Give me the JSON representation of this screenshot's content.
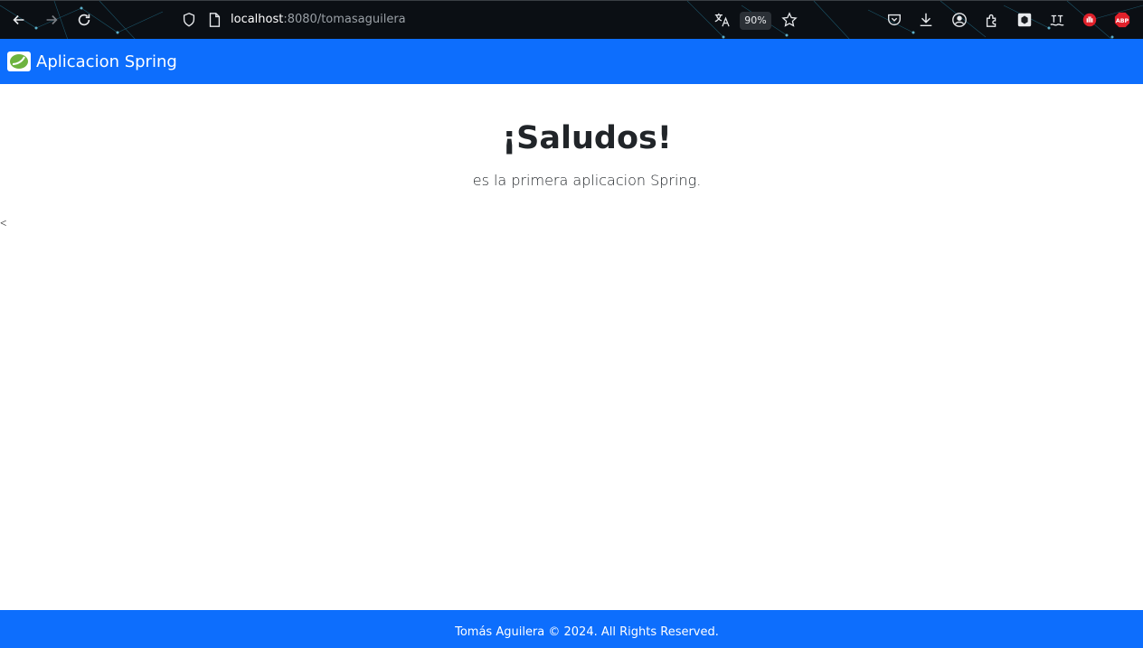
{
  "browser": {
    "url_host": "localhost",
    "url_rest": ":8080/tomasaguilera",
    "zoom": "90%",
    "icons": [
      "back-icon",
      "forward-icon",
      "reload-icon",
      "shield-icon",
      "page-icon",
      "translate-icon",
      "bookmark-star-icon",
      "pocket-icon",
      "download-icon",
      "account-icon",
      "extensions-icon",
      "extension-cube-icon",
      "extension-app-icon",
      "ublock-icon",
      "adblock-plus-icon"
    ],
    "abp_label": "ABP"
  },
  "navbar": {
    "brand": "Aplicacion Spring",
    "color": "#0d6efd"
  },
  "main": {
    "title": "¡Saludos!",
    "subtitle": "es la primera aplicacion Spring.",
    "stray_text": "<"
  },
  "footer": {
    "text": "Tomás Aguilera © 2024. All Rights Reserved."
  }
}
